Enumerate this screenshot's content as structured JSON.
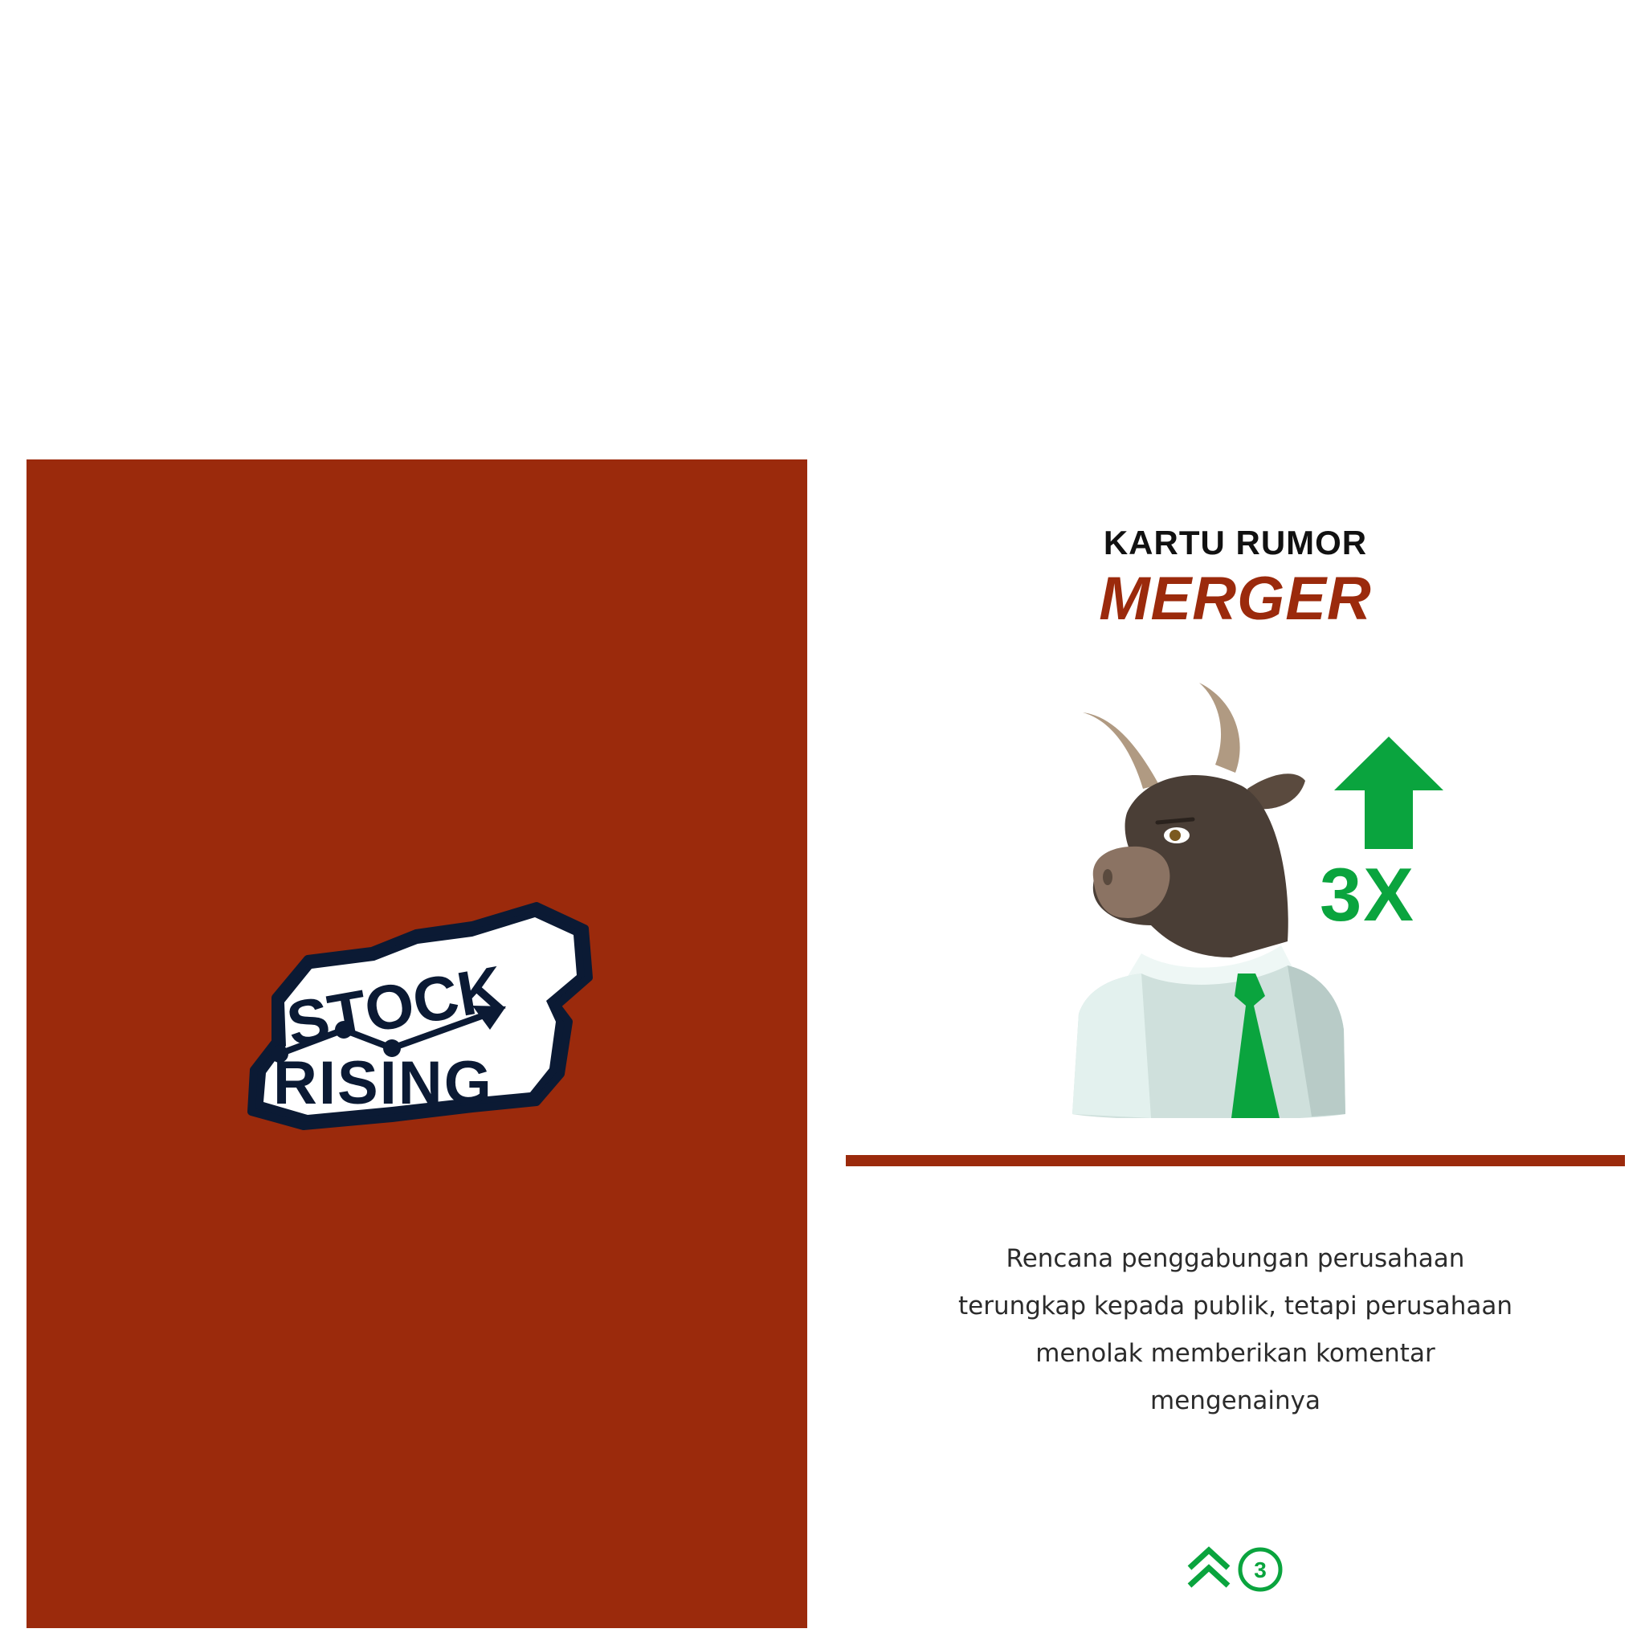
{
  "card_back": {
    "logo_text_line1": "STOCK",
    "logo_text_line2": "RISING",
    "background_color": "#9b2a0c"
  },
  "card_front": {
    "kicker": "KARTU RUMOR",
    "title": "MERGER",
    "multiplier": "3X",
    "description": "Rencana penggabungan perusahaan terungkap kepada publik, tetapi perusahaan menolak memberikan komentar mengenainya",
    "badge_number": "3",
    "accent_color": "#9b2a0c",
    "green_color": "#0aa43e",
    "icons": [
      "bull-illustration",
      "up-arrow-icon",
      "double-chevron-up-icon"
    ]
  }
}
